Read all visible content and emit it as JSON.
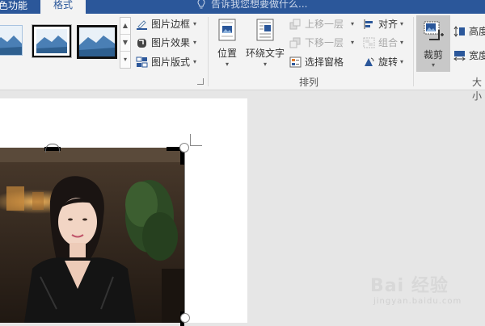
{
  "tabs": {
    "prev_partial": "色功能",
    "active": "格式",
    "tell_me": "告诉我您想要做什么..."
  },
  "picture_styles": {
    "thumbnails": [
      "plain-frame",
      "black-border-frame",
      "thick-black-frame"
    ]
  },
  "style_options": [
    {
      "label": "图片边框",
      "icon": "border-pen-icon"
    },
    {
      "label": "图片效果",
      "icon": "effects-icon"
    },
    {
      "label": "图片版式",
      "icon": "layout-icon"
    }
  ],
  "arrange": {
    "group_label": "排列",
    "position_label": "位置",
    "wrap_label": "环绕文字",
    "bring_forward": "上移一层",
    "send_backward": "下移一层",
    "selection_pane": "选择窗格",
    "align": "对齐",
    "group": "组合",
    "rotate": "旋转"
  },
  "size": {
    "crop_label": "裁剪",
    "height_label": "高度",
    "width_label": "宽度",
    "group_label_partial": "大小"
  },
  "watermark": {
    "brand": "Bai 经验",
    "url": "jingyan.baidu.com"
  },
  "colors": {
    "accent": "#2b579a",
    "ribbon_bg": "#f3f3f3",
    "workspace_bg": "#e6e6e6"
  }
}
